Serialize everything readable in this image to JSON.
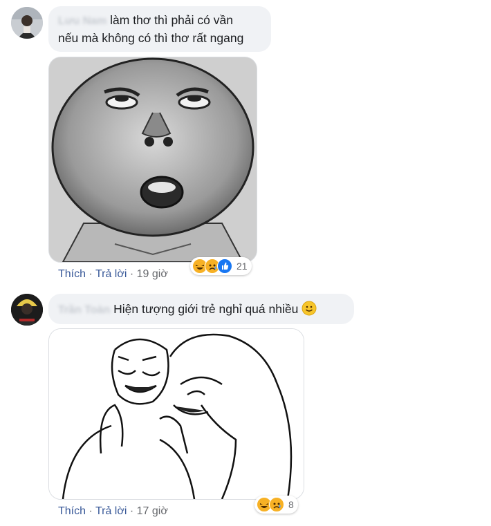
{
  "comments": [
    {
      "author": "Lưu Nam",
      "lines": [
        "làm thơ thì phải có vần",
        "nếu mà không có thì thơ rất ngang"
      ],
      "like_label": "Thích",
      "reply_label": "Trả lời",
      "time": "19 giờ",
      "reaction_count": "21",
      "reactions": [
        "haha",
        "sad",
        "like"
      ],
      "sticker": "round-face-meme-sticker"
    },
    {
      "author": "Trần Toàn",
      "lines": [
        "Hiện tượng giới trẻ nghỉ quá nhiều"
      ],
      "emoji": "smile-emoji",
      "like_label": "Thích",
      "reply_label": "Trả lời",
      "time": "17 giờ",
      "reaction_count": "8",
      "reactions": [
        "haha",
        "sad"
      ],
      "sticker": "laughing-crying-meme-sticker"
    }
  ],
  "separator": " · ",
  "colors": {
    "link": "#385898",
    "meta": "#65676b",
    "bubble": "#f0f2f5",
    "haha": "#f7b125",
    "like": "#1877f2"
  }
}
